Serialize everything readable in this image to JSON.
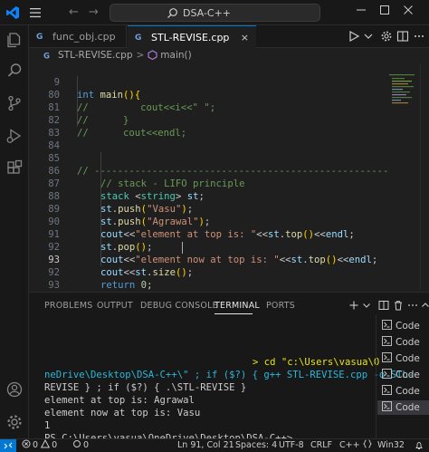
{
  "titlebar": {
    "search_text": "DSA-C++"
  },
  "tabs": [
    {
      "label": "func_obj.cpp",
      "active": false
    },
    {
      "label": "STL-REVISE.cpp",
      "active": true,
      "close": "×"
    }
  ],
  "breadcrumb": {
    "file": "STL-REVISE.cpp",
    "separator": ">",
    "symbol": "main()"
  },
  "editor": {
    "current_line": 91,
    "lines": [
      {
        "n": "9"
      },
      {
        "n": "80"
      },
      {
        "n": "81"
      },
      {
        "n": "82"
      },
      {
        "n": "83"
      },
      {
        "n": "84"
      },
      {
        "n": "85"
      },
      {
        "n": "86"
      },
      {
        "n": "87"
      },
      {
        "n": "88"
      },
      {
        "n": "89"
      },
      {
        "n": "90"
      },
      {
        "n": "91"
      },
      {
        "n": "92"
      },
      {
        "n": "93"
      }
    ],
    "code": {
      "l9_kw": "int",
      "l9_fn": "main",
      "l80": "//         cout<<i<<\" \";",
      "l81": "//      }",
      "l82": "//      cout<<endl;",
      "l85": "// ---------------------------------------------------------------------",
      "l86": "// stack - LIFO principle",
      "l87_ty": "stack",
      "l87_kw": "string",
      "l87_var": "st",
      "l88_var": "st",
      "l88_fn": "push",
      "l88_str": "\"Vasu\"",
      "l89_var": "st",
      "l89_fn": "push",
      "l89_str": "\"Agrawal\"",
      "l90_var": "cout",
      "l90_str": "\"element at top is: \"",
      "l90_var2": "st",
      "l90_fn": "top",
      "l90_var3": "endl",
      "l91_var": "st",
      "l91_fn": "pop",
      "l92_var": "cout",
      "l92_str": "\"element now at top is: \"",
      "l92_var2": "st",
      "l92_fn": "top",
      "l92_var3": "endl",
      "l93_var": "cout",
      "l93_var2": "st",
      "l93_fn": "size",
      "l94_kw": "return",
      "l94_num": "0"
    }
  },
  "panel": {
    "tabs": [
      "PROBLEMS",
      "OUTPUT",
      "DEBUG CONSOLE",
      "TERMINAL",
      "PORTS"
    ],
    "active_tab": "TERMINAL",
    "terminal_lines": [
      "> cd \"c:\\Users\\vasua\\O",
      "neDrive\\Desktop\\DSA-C++\\\" ; if ($?) { g++ STL-REVISE.cpp -o STL-",
      "REVISE } ; if ($?) { .\\STL-REVISE }",
      "element at top is: Agrawal",
      "element now at top is: Vasu",
      "1",
      "PS C:\\Users\\vasua\\OneDrive\\Desktop\\DSA-C++> "
    ],
    "terminal_list": [
      "Code",
      "Code",
      "Code",
      "Code",
      "Code",
      "Code"
    ],
    "selected_terminal_index": 5
  },
  "statusbar": {
    "errors": "0",
    "warnings": "0",
    "ports": "0",
    "cursor": "Ln 91, Col 21",
    "spaces": "Spaces: 4",
    "encoding": "UTF-8",
    "eol": "CRLF",
    "language": "C++",
    "platform": "Win32"
  },
  "colors": {
    "accent": "#0078d4",
    "editor_bg": "#1f1f1f",
    "chrome_bg": "#181818"
  }
}
